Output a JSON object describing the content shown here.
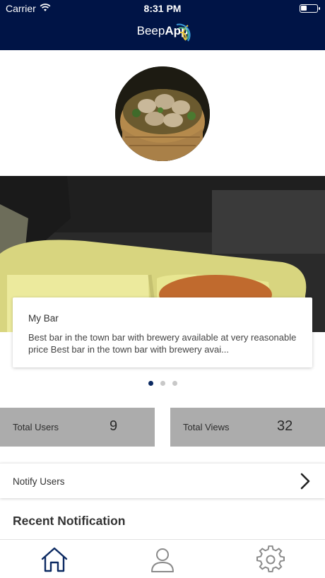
{
  "status_bar": {
    "carrier": "Carrier",
    "time": "8:31 PM",
    "wifi_icon": "wifi-icon",
    "battery_icon": "battery-icon"
  },
  "header": {
    "logo_text_1": "Beep",
    "logo_text_2": "App",
    "background": "#001446"
  },
  "carousel": {
    "card_title": "My Bar",
    "card_description": "Best bar in the town bar with brewery available at very reasonable price Best bar in the town bar with brewery avai...",
    "page_count": 3,
    "active_page": 1
  },
  "stats": {
    "users_label": "Total Users",
    "users_value": "9",
    "views_label": "Total Views",
    "views_value": "32"
  },
  "notify": {
    "label": "Notify Users",
    "icon": "chevron-right-icon"
  },
  "recent": {
    "heading": "Recent Notification"
  },
  "tabbar": {
    "items": [
      {
        "icon": "home-icon",
        "active": true
      },
      {
        "icon": "user-icon",
        "active": false
      },
      {
        "icon": "gear-icon",
        "active": false
      }
    ],
    "active_color": "#0c2a62",
    "inactive_color": "#8a8a8a"
  }
}
